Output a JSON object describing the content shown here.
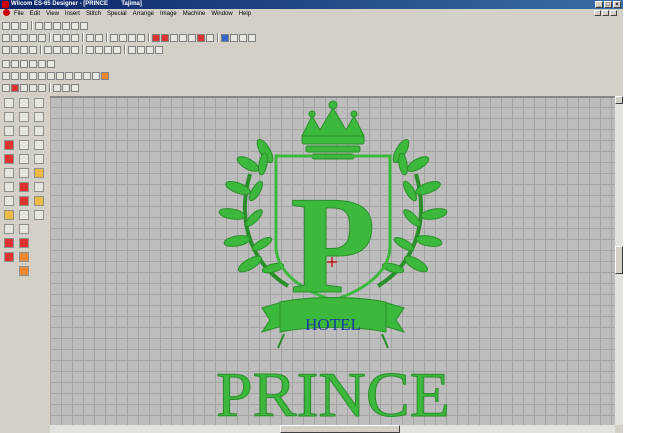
{
  "window": {
    "title": "Wilcom ES-65 Designer - [PRINCE",
    "title_suffix": "Tajima]",
    "minimize_label": "_",
    "maximize_label": "□",
    "close_label": "×"
  },
  "menu": [
    "File",
    "Edit",
    "View",
    "Insert",
    "Stitch",
    "Special",
    "Arrange",
    "Image",
    "Machine",
    "Window",
    "Help"
  ],
  "design": {
    "monogram": "P",
    "banner_text": "HOTEL",
    "name_text": "PRINCE",
    "embroidery_color": "#3cb83c",
    "banner_text_color": "#1a3aa0",
    "needle_marker_color": "#c00000"
  },
  "colors": {
    "grid_background": "#bdbdbd",
    "grid_lines": "#a4a4a4",
    "title_bar": "#0a246a"
  }
}
